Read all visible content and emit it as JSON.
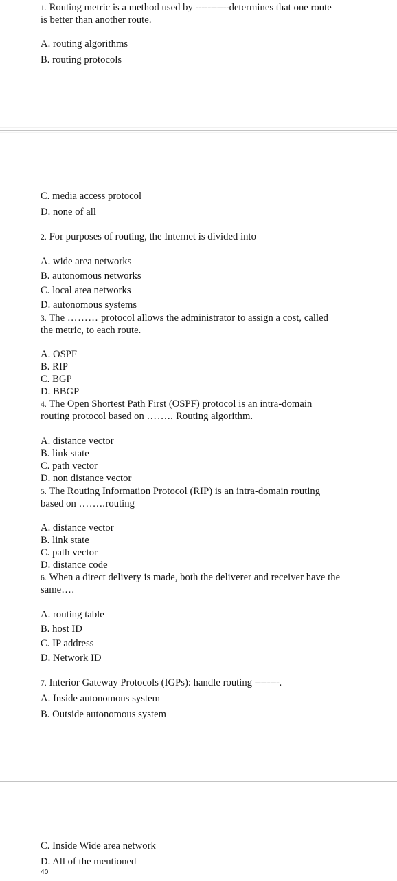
{
  "document": {
    "type": "scanned-exam-page",
    "page_number": "40",
    "background": "#ffffff",
    "text_color": "#161616",
    "separator_color": "#c3c3c3"
  },
  "lines": {
    "q1_text_a": "1.",
    "q1_text_b": " Routing metric is a method used by ",
    "q1_dashes": "-----------",
    "q1_text_c": "determines that one route",
    "q1_text_d": "is better than another route.",
    "q1_opt_a": "A. routing algorithms",
    "q1_opt_b": "B. routing protocols",
    "q1_opt_c": "C. media access protocol",
    "q1_opt_d": "D. none of all",
    "q2_num": "2.",
    "q2_text": " For purposes of routing, the Internet is divided into",
    "q2_opt_a": "A. wide area networks",
    "q2_opt_b": "B. autonomous networks",
    "q2_opt_c": "C. local area networks",
    "q2_opt_d": "D. autonomous systems",
    "q3_num": "3.",
    "q3_text_a": " The ",
    "q3_dots": "………",
    "q3_text_b": " protocol allows the administrator to assign a cost, called",
    "q3_text_c": "the metric, to each route.",
    "q3_opt_a": "A. OSPF",
    "q3_opt_b": "B. RIP",
    "q3_opt_c": "C. BGP",
    "q3_opt_d": "D. BBGP",
    "q4_num": "4.",
    "q4_text_a": " The Open Shortest Path First (OSPF) protocol is an intra-domain",
    "q4_text_b": "routing protocol based on ",
    "q4_dots": "……..",
    "q4_text_c": " Routing algorithm.",
    "q4_opt_a": "A. distance vector",
    "q4_opt_b": "B. link state",
    "q4_opt_c": "C. path vector",
    "q4_opt_d": "D. non distance vector",
    "q5_num": "5.",
    "q5_text_a": " The Routing Information Protocol (RIP) is an intra-domain routing",
    "q5_text_b": "based on ",
    "q5_dots": "……..",
    "q5_text_c": "routing",
    "q5_opt_a": "A. distance vector",
    "q5_opt_b": "B. link state",
    "q5_opt_c": "C. path vector",
    "q5_opt_d": "D. distance code",
    "q6_num": "6.",
    "q6_text_a": " When a direct delivery is made, both the deliverer and receiver have the",
    "q6_text_b": "same",
    "q6_dots": "….",
    "q6_opt_a": "A. routing table",
    "q6_opt_b": "B. host ID",
    "q6_opt_c": "C. IP address",
    "q6_opt_d": "D. Network ID",
    "q7_num": "7.",
    "q7_text_a": " Interior Gateway Protocols (IGPs): handle routing ",
    "q7_dashes": "--------",
    "q7_text_b": ".",
    "q7_opt_a": "A. Inside autonomous system",
    "q7_opt_b": "B. Outside autonomous system",
    "q7_opt_c": "C. Inside Wide area network",
    "q7_opt_d": "D. All of the mentioned"
  }
}
